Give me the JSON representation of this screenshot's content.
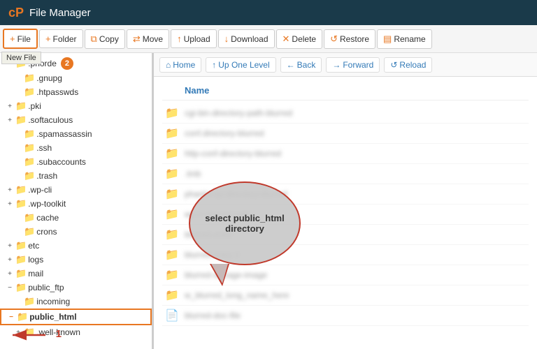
{
  "topbar": {
    "logo": "cP",
    "title": "File Manager"
  },
  "toolbar": {
    "buttons": [
      {
        "id": "new-file",
        "icon": "+",
        "label": "File",
        "active": true
      },
      {
        "id": "new-folder",
        "icon": "+",
        "label": "Folder"
      },
      {
        "id": "copy",
        "icon": "⧉",
        "label": "Copy"
      },
      {
        "id": "move",
        "icon": "⇄",
        "label": "Move"
      },
      {
        "id": "upload",
        "icon": "↑",
        "label": "Upload"
      },
      {
        "id": "download",
        "icon": "↓",
        "label": "Download"
      },
      {
        "id": "delete",
        "icon": "✕",
        "label": "Delete"
      },
      {
        "id": "restore",
        "icon": "↺",
        "label": "Restore"
      },
      {
        "id": "rename",
        "icon": "▤",
        "label": "Rename"
      }
    ],
    "tooltip": "New File"
  },
  "navbar": {
    "buttons": [
      {
        "id": "home",
        "icon": "⌂",
        "label": "Home"
      },
      {
        "id": "up-one-level",
        "icon": "↑",
        "label": "Up One Level"
      },
      {
        "id": "back",
        "icon": "←",
        "label": "Back"
      },
      {
        "id": "forward",
        "icon": "→",
        "label": "Forward"
      },
      {
        "id": "reload",
        "icon": "↺",
        "label": "Reload"
      }
    ]
  },
  "file_list": {
    "col_header": "Name",
    "items": [
      {
        "type": "folder",
        "name": "blurred1",
        "blurred": true
      },
      {
        "type": "folder",
        "name": "blurred2",
        "blurred": true
      },
      {
        "type": "folder",
        "name": "blurred3",
        "blurred": true
      },
      {
        "type": "folder",
        "name": ".tmb",
        "blurred": true
      },
      {
        "type": "folder",
        "name": "blurred4",
        "blurred": true
      },
      {
        "type": "folder",
        "name": "wp-d blurred",
        "blurred": true
      },
      {
        "type": "folder",
        "name": "blurred5",
        "blurred": true
      },
      {
        "type": "folder",
        "name": "blurred6",
        "blurred": true
      },
      {
        "type": "folder",
        "name": "blurred-image",
        "blurred": true
      },
      {
        "type": "folder",
        "name": "w_blurred_long",
        "blurred": true
      },
      {
        "type": "doc",
        "name": "blurred-doc",
        "blurred": true
      }
    ]
  },
  "tree": {
    "items": [
      {
        "label": ".phorde",
        "indent": 1,
        "expand": "",
        "badge": 2
      },
      {
        "label": ".gnupg",
        "indent": 2,
        "expand": ""
      },
      {
        "label": ".htpasswds",
        "indent": 2,
        "expand": ""
      },
      {
        "label": ".pki",
        "indent": 1,
        "expand": "+"
      },
      {
        "label": ".softaculous",
        "indent": 1,
        "expand": "+"
      },
      {
        "label": ".spamassassin",
        "indent": 2,
        "expand": ""
      },
      {
        "label": ".ssh",
        "indent": 2,
        "expand": ""
      },
      {
        "label": ".subaccounts",
        "indent": 2,
        "expand": ""
      },
      {
        "label": ".trash",
        "indent": 2,
        "expand": ""
      },
      {
        "label": ".wp-cli",
        "indent": 1,
        "expand": "+"
      },
      {
        "label": ".wp-toolkit",
        "indent": 1,
        "expand": "+"
      },
      {
        "label": "cache",
        "indent": 2,
        "expand": ""
      },
      {
        "label": "crons",
        "indent": 2,
        "expand": ""
      },
      {
        "label": "etc",
        "indent": 1,
        "expand": "+"
      },
      {
        "label": "logs",
        "indent": 1,
        "expand": "+"
      },
      {
        "label": "mail",
        "indent": 1,
        "expand": "+"
      },
      {
        "label": "public_ftp",
        "indent": 1,
        "expand": "−"
      },
      {
        "label": "incoming",
        "indent": 2,
        "expand": ""
      },
      {
        "label": "public_html",
        "indent": 1,
        "expand": "−",
        "selected": true
      },
      {
        "label": ".well-known",
        "indent": 2,
        "expand": "+"
      }
    ]
  },
  "callout": {
    "text": "select public_html directory"
  },
  "annotations": {
    "arrow_label": "1"
  }
}
